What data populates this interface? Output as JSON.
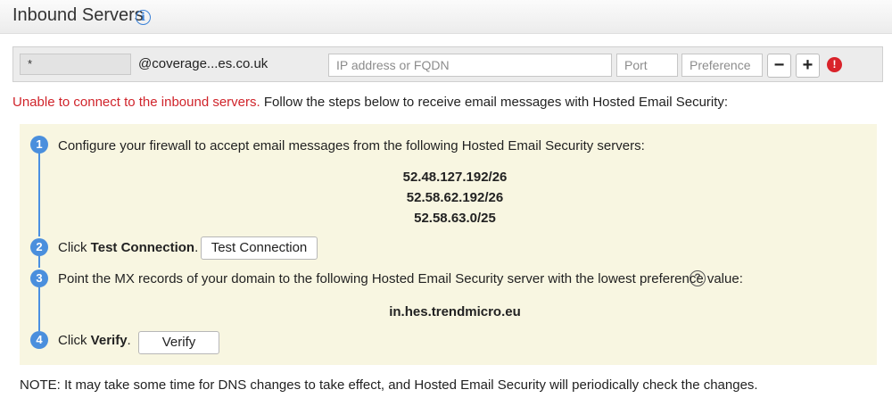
{
  "header": {
    "title": "Inbound Servers",
    "info_icon": "info-icon"
  },
  "server_row": {
    "host_value": "*",
    "domain": "@coverage...es.co.uk",
    "ip_placeholder": "IP address or FQDN",
    "port_placeholder": "Port",
    "preference_placeholder": "Preference",
    "minus_label": "−",
    "plus_label": "+",
    "error_glyph": "!"
  },
  "message": {
    "error_text": "Unable to connect to the inbound servers.",
    "rest_text": " Follow the steps below to receive email messages with Hosted Email Security:"
  },
  "steps": [
    {
      "number": "1",
      "text": "Configure your firewall to accept email messages from the following Hosted Email Security servers:"
    },
    {
      "number": "2",
      "prefix": "Click ",
      "bold": "Test Connection",
      "suffix": ".",
      "button_label": "Test Connection"
    },
    {
      "number": "3",
      "text": "Point the MX records of your domain to the following Hosted Email Security server with the lowest preference value:"
    },
    {
      "number": "4",
      "prefix": "Click ",
      "bold": "Verify",
      "suffix": ".",
      "button_label": "Verify"
    }
  ],
  "servers": [
    "52.48.127.192/26",
    "52.58.62.192/26",
    "52.58.63.0/25"
  ],
  "mx_server": "in.hes.trendmicro.eu",
  "help_glyph": "?",
  "note": "NOTE: It may take some time for DNS changes to take effect, and Hosted Email Security will periodically check the changes.",
  "colors": {
    "error_red": "#d0242b",
    "step_blue": "#4a8fdd",
    "box_bg": "#f8f6e1"
  }
}
